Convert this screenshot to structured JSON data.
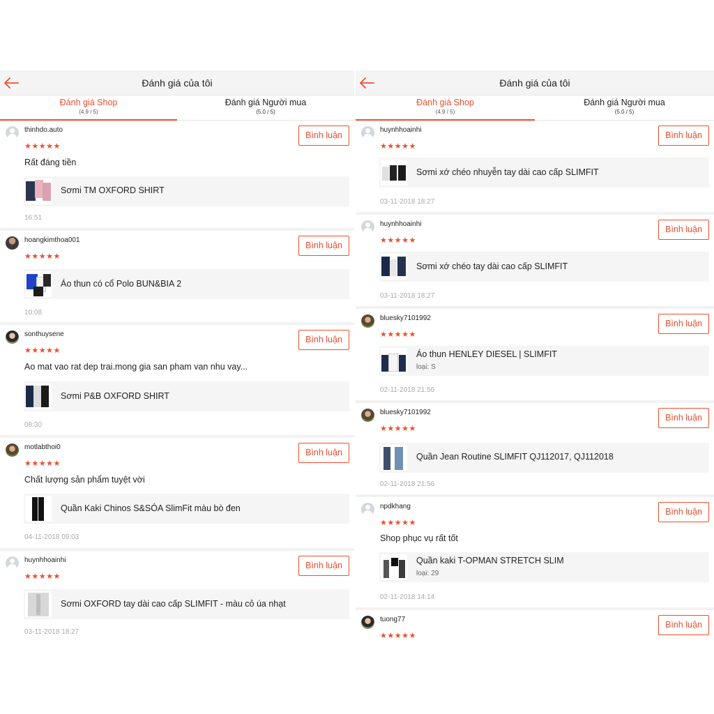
{
  "panels": [
    {
      "title": "Đánh giá của tôi",
      "tabs": [
        {
          "label": "Đánh giá Shop",
          "score": "(4.9 / 5)",
          "active": true
        },
        {
          "label": "Đánh giá Người mua",
          "score": "(5.0 / 5)",
          "active": false
        }
      ],
      "reviews": [
        {
          "username": "thinhdo.auto",
          "avatar": "default-avatar",
          "stars": "★★★★★",
          "rating": 5,
          "comment_label": "Bình luận",
          "text": "Rất đáng tiền",
          "product": "Sơmi TM OXFORD SHIRT",
          "variant": "",
          "time": "16:51"
        },
        {
          "username": "hoangkimthoa001",
          "avatar": "user-photo",
          "stars": "★★★★★",
          "rating": 5,
          "comment_label": "Bình luận",
          "text": "",
          "product": "Áo thun có cổ Polo BUN&BIA 2",
          "variant": "",
          "time": "10:08"
        },
        {
          "username": "sonthuysene",
          "avatar": "user-photo",
          "stars": "★★★★★",
          "rating": 5,
          "comment_label": "Bình luận",
          "text": "Ao mat vao rat dep trai.mong gia san pham van nhu vay...",
          "product": "Sơmi P&B OXFORD SHIRT",
          "variant": "",
          "time": "08:30"
        },
        {
          "username": "motlabthoi0",
          "avatar": "user-photo",
          "stars": "★★★★★",
          "rating": 5,
          "comment_label": "Bình luận",
          "text": "Chất lượng sản phẩm tuyệt vời",
          "product": "Quần Kaki Chinos S&SÓA SlimFit màu bò đen",
          "variant": "",
          "time": "04-11-2018 09:03"
        },
        {
          "username": "huynhhoainhi",
          "avatar": "default-avatar",
          "stars": "★★★★★",
          "rating": 5,
          "comment_label": "Bình luận",
          "text": "",
          "product": "Sơmi OXFORD tay dài cao cấp SLIMFIT - màu cỏ úa nhạt",
          "variant": "",
          "time": "03-11-2018 18:27"
        }
      ]
    },
    {
      "title": "Đánh giá của tôi",
      "tabs": [
        {
          "label": "Đánh giá Shop",
          "score": "(4.9 / 5)",
          "active": true
        },
        {
          "label": "Đánh giá Người mua",
          "score": "(5.0 / 5)",
          "active": false
        }
      ],
      "reviews": [
        {
          "username": "huynhhoainhi",
          "avatar": "default-avatar",
          "stars": "★★★★★",
          "rating": 5,
          "comment_label": "Bình luận",
          "text": "",
          "product": "Sơmi xớ chéo nhuyễn tay dài cao cấp SLIMFIT",
          "variant": "",
          "time": "03-11-2018 18:27"
        },
        {
          "username": "huynhhoainhi",
          "avatar": "default-avatar",
          "stars": "★★★★★",
          "rating": 5,
          "comment_label": "Bình luận",
          "text": "",
          "product": "Sơmi xớ chéo tay dài cao cấp SLIMFIT",
          "variant": "",
          "time": "03-11-2018 18:27"
        },
        {
          "username": "bluesky7101992",
          "avatar": "user-photo",
          "stars": "★★★★★",
          "rating": 5,
          "comment_label": "Bình luận",
          "text": "",
          "product": "Áo thun HENLEY DIESEL | SLIMFIT",
          "variant": "loại: S",
          "time": "02-11-2018 21:56"
        },
        {
          "username": "bluesky7101992",
          "avatar": "user-photo",
          "stars": "★★★★★",
          "rating": 5,
          "comment_label": "Bình luận",
          "text": "",
          "product": "Quần Jean Routine SLIMFIT QJ112017, QJ112018",
          "variant": "",
          "time": "02-11-2018 21:56"
        },
        {
          "username": "npdkhang",
          "avatar": "default-avatar",
          "stars": "★★★★★",
          "rating": 5,
          "comment_label": "Bình luận",
          "text": "Shop phục vụ rất tốt",
          "product": "Quần kaki T-OPMAN STRETCH SLIM",
          "variant": "loại: 29",
          "time": "02-11-2018 14:14"
        },
        {
          "username": "tuong77",
          "avatar": "user-photo",
          "stars": "★★★★★",
          "rating": 5,
          "comment_label": "Bình luận",
          "text": "",
          "product": "",
          "variant": "",
          "time": ""
        }
      ]
    }
  ],
  "colors": {
    "accent": "#ee4d2d",
    "product_bg": "#f5f5f5",
    "header_bg": "#f4f4f4"
  }
}
